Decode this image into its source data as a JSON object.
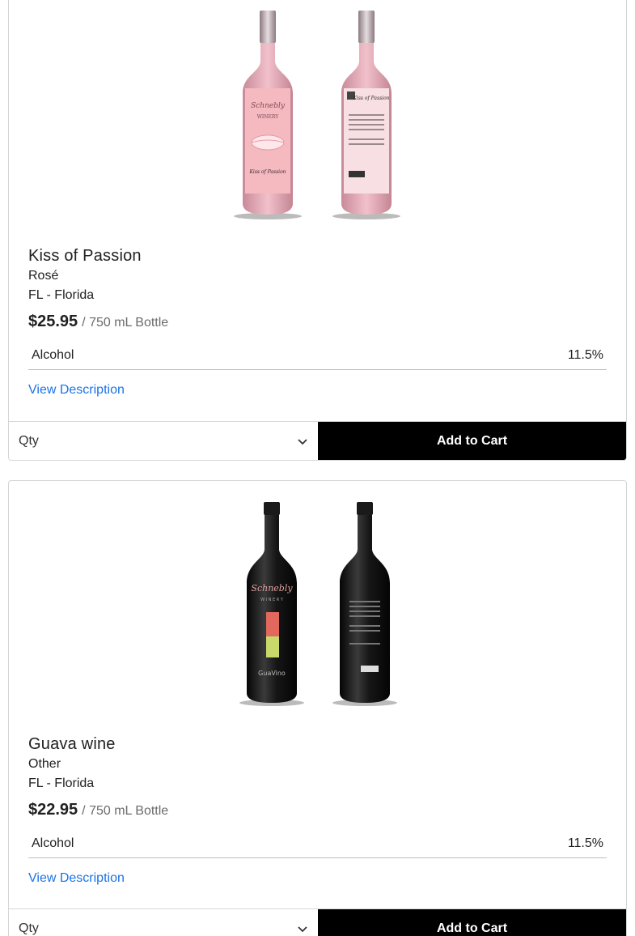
{
  "products": [
    {
      "name": "Kiss of Passion",
      "varietal": "Rosé",
      "region": "FL - Florida",
      "price": "$25.95",
      "unit": "/ 750 mL Bottle",
      "attribute": {
        "label": "Alcohol",
        "value": "11.5%"
      },
      "link": "View Description",
      "qty_placeholder": "Qty",
      "cart_label": "Add to Cart",
      "bottle_color": "#e8a9b4",
      "label_color": "#f2c4cc"
    },
    {
      "name": "Guava wine",
      "varietal": "Other",
      "region": "FL - Florida",
      "price": "$22.95",
      "unit": "/ 750 mL Bottle",
      "attribute": {
        "label": "Alcohol",
        "value": "11.5%"
      },
      "link": "View Description",
      "qty_placeholder": "Qty",
      "cart_label": "Add to Cart",
      "bottle_color": "#151515",
      "label_color": "#2a2a2a"
    }
  ]
}
